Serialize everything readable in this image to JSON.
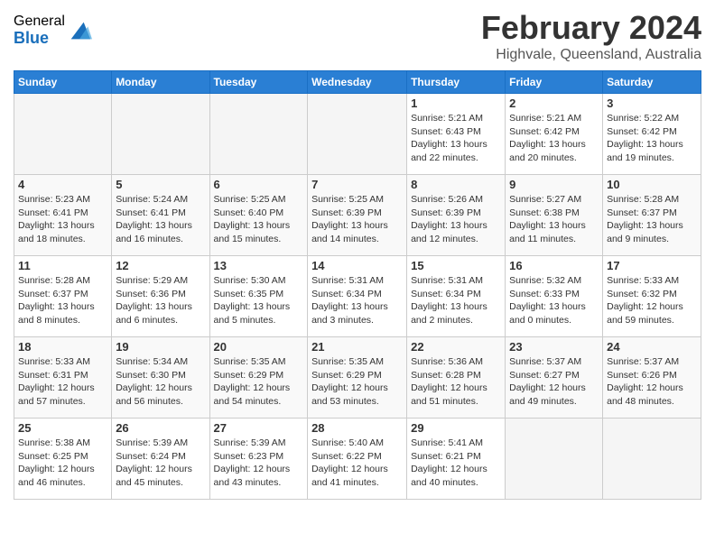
{
  "header": {
    "logo_general": "General",
    "logo_blue": "Blue",
    "month_title": "February 2024",
    "location": "Highvale, Queensland, Australia"
  },
  "days_of_week": [
    "Sunday",
    "Monday",
    "Tuesday",
    "Wednesday",
    "Thursday",
    "Friday",
    "Saturday"
  ],
  "weeks": [
    {
      "bg": "1",
      "days": [
        {
          "date": "",
          "empty": true
        },
        {
          "date": "",
          "empty": true
        },
        {
          "date": "",
          "empty": true
        },
        {
          "date": "",
          "empty": true
        },
        {
          "date": "1",
          "sunrise": "5:21 AM",
          "sunset": "6:43 PM",
          "daylight": "13 hours and 22 minutes."
        },
        {
          "date": "2",
          "sunrise": "5:21 AM",
          "sunset": "6:42 PM",
          "daylight": "13 hours and 20 minutes."
        },
        {
          "date": "3",
          "sunrise": "5:22 AM",
          "sunset": "6:42 PM",
          "daylight": "13 hours and 19 minutes."
        }
      ]
    },
    {
      "bg": "2",
      "days": [
        {
          "date": "4",
          "sunrise": "5:23 AM",
          "sunset": "6:41 PM",
          "daylight": "13 hours and 18 minutes."
        },
        {
          "date": "5",
          "sunrise": "5:24 AM",
          "sunset": "6:41 PM",
          "daylight": "13 hours and 16 minutes."
        },
        {
          "date": "6",
          "sunrise": "5:25 AM",
          "sunset": "6:40 PM",
          "daylight": "13 hours and 15 minutes."
        },
        {
          "date": "7",
          "sunrise": "5:25 AM",
          "sunset": "6:39 PM",
          "daylight": "13 hours and 14 minutes."
        },
        {
          "date": "8",
          "sunrise": "5:26 AM",
          "sunset": "6:39 PM",
          "daylight": "13 hours and 12 minutes."
        },
        {
          "date": "9",
          "sunrise": "5:27 AM",
          "sunset": "6:38 PM",
          "daylight": "13 hours and 11 minutes."
        },
        {
          "date": "10",
          "sunrise": "5:28 AM",
          "sunset": "6:37 PM",
          "daylight": "13 hours and 9 minutes."
        }
      ]
    },
    {
      "bg": "1",
      "days": [
        {
          "date": "11",
          "sunrise": "5:28 AM",
          "sunset": "6:37 PM",
          "daylight": "13 hours and 8 minutes."
        },
        {
          "date": "12",
          "sunrise": "5:29 AM",
          "sunset": "6:36 PM",
          "daylight": "13 hours and 6 minutes."
        },
        {
          "date": "13",
          "sunrise": "5:30 AM",
          "sunset": "6:35 PM",
          "daylight": "13 hours and 5 minutes."
        },
        {
          "date": "14",
          "sunrise": "5:31 AM",
          "sunset": "6:34 PM",
          "daylight": "13 hours and 3 minutes."
        },
        {
          "date": "15",
          "sunrise": "5:31 AM",
          "sunset": "6:34 PM",
          "daylight": "13 hours and 2 minutes."
        },
        {
          "date": "16",
          "sunrise": "5:32 AM",
          "sunset": "6:33 PM",
          "daylight": "13 hours and 0 minutes."
        },
        {
          "date": "17",
          "sunrise": "5:33 AM",
          "sunset": "6:32 PM",
          "daylight": "12 hours and 59 minutes."
        }
      ]
    },
    {
      "bg": "2",
      "days": [
        {
          "date": "18",
          "sunrise": "5:33 AM",
          "sunset": "6:31 PM",
          "daylight": "12 hours and 57 minutes."
        },
        {
          "date": "19",
          "sunrise": "5:34 AM",
          "sunset": "6:30 PM",
          "daylight": "12 hours and 56 minutes."
        },
        {
          "date": "20",
          "sunrise": "5:35 AM",
          "sunset": "6:29 PM",
          "daylight": "12 hours and 54 minutes."
        },
        {
          "date": "21",
          "sunrise": "5:35 AM",
          "sunset": "6:29 PM",
          "daylight": "12 hours and 53 minutes."
        },
        {
          "date": "22",
          "sunrise": "5:36 AM",
          "sunset": "6:28 PM",
          "daylight": "12 hours and 51 minutes."
        },
        {
          "date": "23",
          "sunrise": "5:37 AM",
          "sunset": "6:27 PM",
          "daylight": "12 hours and 49 minutes."
        },
        {
          "date": "24",
          "sunrise": "5:37 AM",
          "sunset": "6:26 PM",
          "daylight": "12 hours and 48 minutes."
        }
      ]
    },
    {
      "bg": "1",
      "days": [
        {
          "date": "25",
          "sunrise": "5:38 AM",
          "sunset": "6:25 PM",
          "daylight": "12 hours and 46 minutes."
        },
        {
          "date": "26",
          "sunrise": "5:39 AM",
          "sunset": "6:24 PM",
          "daylight": "12 hours and 45 minutes."
        },
        {
          "date": "27",
          "sunrise": "5:39 AM",
          "sunset": "6:23 PM",
          "daylight": "12 hours and 43 minutes."
        },
        {
          "date": "28",
          "sunrise": "5:40 AM",
          "sunset": "6:22 PM",
          "daylight": "12 hours and 41 minutes."
        },
        {
          "date": "29",
          "sunrise": "5:41 AM",
          "sunset": "6:21 PM",
          "daylight": "12 hours and 40 minutes."
        },
        {
          "date": "",
          "empty": true
        },
        {
          "date": "",
          "empty": true
        }
      ]
    }
  ],
  "labels": {
    "sunrise_prefix": "Sunrise: ",
    "sunset_prefix": "Sunset: ",
    "daylight_prefix": "Daylight: "
  }
}
